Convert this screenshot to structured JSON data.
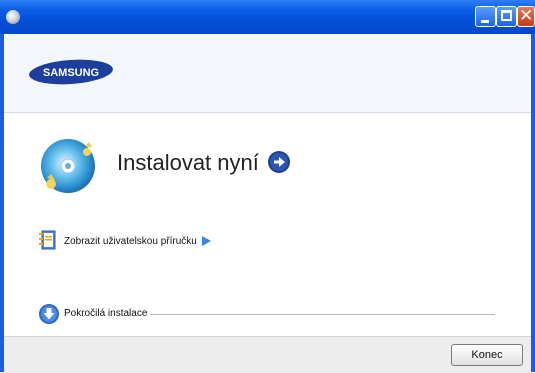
{
  "window": {
    "minimize_icon": "minimize-icon",
    "maximize_icon": "maximize-icon",
    "close_icon": "close-icon",
    "close_glyph": "✕",
    "titlebar_color": "#0450d8"
  },
  "header": {
    "logo_text": "SAMSUNG",
    "logo_color": "#1b3f9a"
  },
  "main": {
    "title": "Instalovat nyní",
    "title_icon": "disc-install-icon",
    "arrow_icon": "arrow-right-circle-icon"
  },
  "links": {
    "user_manual": "Zobrazit uživatelskou příručku",
    "user_manual_icon": "manual-icon",
    "advanced_install": "Pokročilá instalace",
    "advanced_icon": "expand-down-icon"
  },
  "footer": {
    "finish_button": "Konec"
  }
}
